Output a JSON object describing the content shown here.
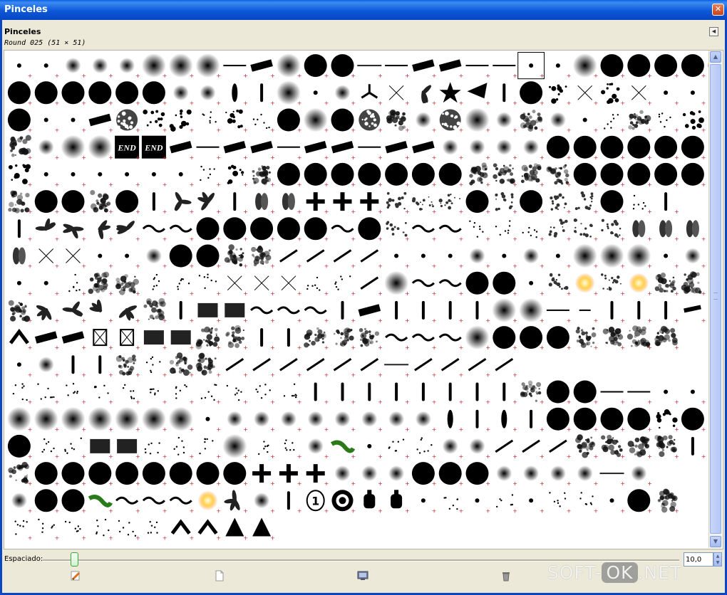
{
  "window": {
    "title": "Pinceles",
    "close_glyph": "✕"
  },
  "panel": {
    "title": "Pinceles",
    "selected_brush": "Round  025 (51 × 51)",
    "menu_icon": "triangle-left-icon"
  },
  "spacing": {
    "label": "Espaciado:",
    "value": "10,0",
    "fraction": 0.1
  },
  "bottom_buttons": [
    {
      "name": "edit-brush-button",
      "icon": "pencil-icon"
    },
    {
      "name": "new-brush-button",
      "icon": "page-icon"
    },
    {
      "name": "duplicate-brush-button",
      "icon": "monitor-icon"
    },
    {
      "name": "delete-brush-button",
      "icon": "trash-icon"
    }
  ],
  "watermark": {
    "left": "SOFT-",
    "ok": "OK",
    "right": ".NET"
  },
  "colors": {
    "titlebar": "#0a5fe0",
    "frame": "#ece9d8",
    "selection": "#000000"
  },
  "brush_grid": {
    "columns": 26,
    "selected_index": 19,
    "rows": [
      "..oooOOO-=O@@_-==--..O@@@@@@@.",
      "@@@@@@oo)|O.oyxkv?|@sxsx..",
      "@..=#ss:s:@O@#ro#Ooro.:r:s",
      "roOOEE=-==-==-==oooo@@@@@@",
      "s......:sr@@@@@@@rrrr@@@@@",
      "r@@r@|kk|88+++%%%@%@%%@:|",
      "|kkkk~~@@@@@~@%~~:::%%%888",
      "8xx..o@@rr////...o.o.OOO.o.o",
      "..:rr:::xxx::/O~~@@.%*%*rr",
      "rkkkkr|BB~~~|=||||OO-!|||z^",
      "^==XXBBrr||rrr~~~O@@@rrrr",
      ".o||r:rr//////_////",
      ":::::::::::||||||||r@@--..",
      "OOOOOOO.oooooooo)|)|@@@@s@",
      "@::BB:::O::ow.::oo///rrrr|",
      "r@@@@@@@@+++ooo@@@oooo_o",
      "o@@w~~~*ko|10dd.:.:.::.@r",
      "::::::^^AA"
    ]
  }
}
